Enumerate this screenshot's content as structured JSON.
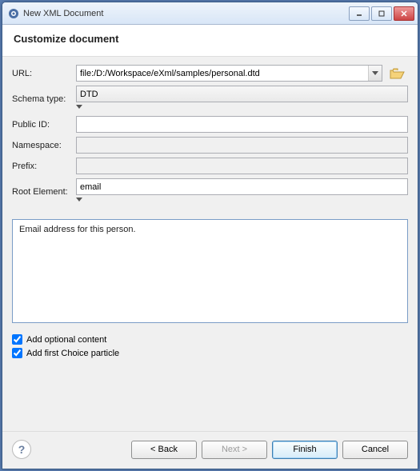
{
  "window": {
    "title": "New XML Document"
  },
  "header": {
    "title": "Customize document"
  },
  "form": {
    "url_label": "URL:",
    "url_value": "file:/D:/Workspace/eXml/samples/personal.dtd",
    "schema_label": "Schema type:",
    "schema_value": "DTD",
    "publicid_label": "Public ID:",
    "publicid_value": "",
    "namespace_label": "Namespace:",
    "namespace_value": "",
    "prefix_label": "Prefix:",
    "prefix_value": "",
    "root_label": "Root Element:",
    "root_value": "email"
  },
  "description": "Email address for this person.",
  "checks": {
    "optional": {
      "label": "Add optional content",
      "checked": true
    },
    "choice": {
      "label": "Add first Choice particle",
      "checked": true
    }
  },
  "buttons": {
    "back": "< Back",
    "next": "Next >",
    "finish": "Finish",
    "cancel": "Cancel"
  }
}
